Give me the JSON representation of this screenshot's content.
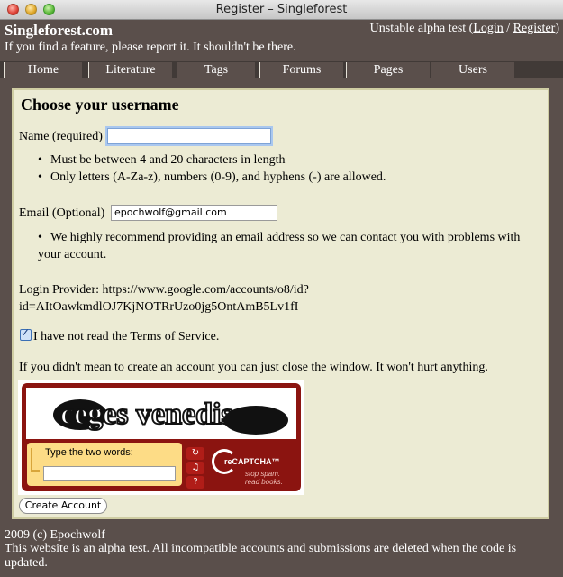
{
  "window": {
    "title": "Register – Singleforest"
  },
  "header": {
    "site_title": "Singleforest.com",
    "tagline": "If you find a feature, please report it. It shouldn't be there.",
    "status_prefix": "Unstable alpha test (",
    "login": "Login",
    "separator": " / ",
    "register": "Register",
    "status_suffix": ")"
  },
  "tabs": [
    "Home",
    "Literature",
    "Tags",
    "Forums",
    "Pages",
    "Users"
  ],
  "form": {
    "heading": "Choose your username",
    "name_label": "Name (required)",
    "name_value": "",
    "name_rules": [
      "Must be between 4 and 20 characters in length",
      "Only letters (A-Za-z), numbers (0-9), and hyphens (-) are allowed."
    ],
    "email_label": "Email (Optional)",
    "email_value": "epochwolf@gmail.com",
    "email_note_line1": "We highly recommend providing an email address so we can contact you with problems with",
    "email_note_line2": "your account.",
    "provider_line1": "Login Provider: https://www.google.com/accounts/o8/id?",
    "provider_line2": "id=AItOawkmdlOJ7KjNOTRrUzo0jg5OntAmB5Lv1fI",
    "tos_checked": true,
    "tos_label": "I have not read the Terms of Service.",
    "close_note": "If you didn't mean to create an account you can just close the window. It won't hurt anything.",
    "submit_label": "Create Account"
  },
  "captcha": {
    "words_image": "ceges venedis",
    "prompt": "Type the two words:",
    "brand": "reCAPTCHA™",
    "slogan_line1": "stop spam.",
    "slogan_line2": "read books."
  },
  "footer": {
    "copyright": "2009 (c) Epochwolf",
    "notice_line1": "This website is an alpha test. All incompatible accounts and submissions are deleted when the code is",
    "notice_line2": "updated."
  }
}
